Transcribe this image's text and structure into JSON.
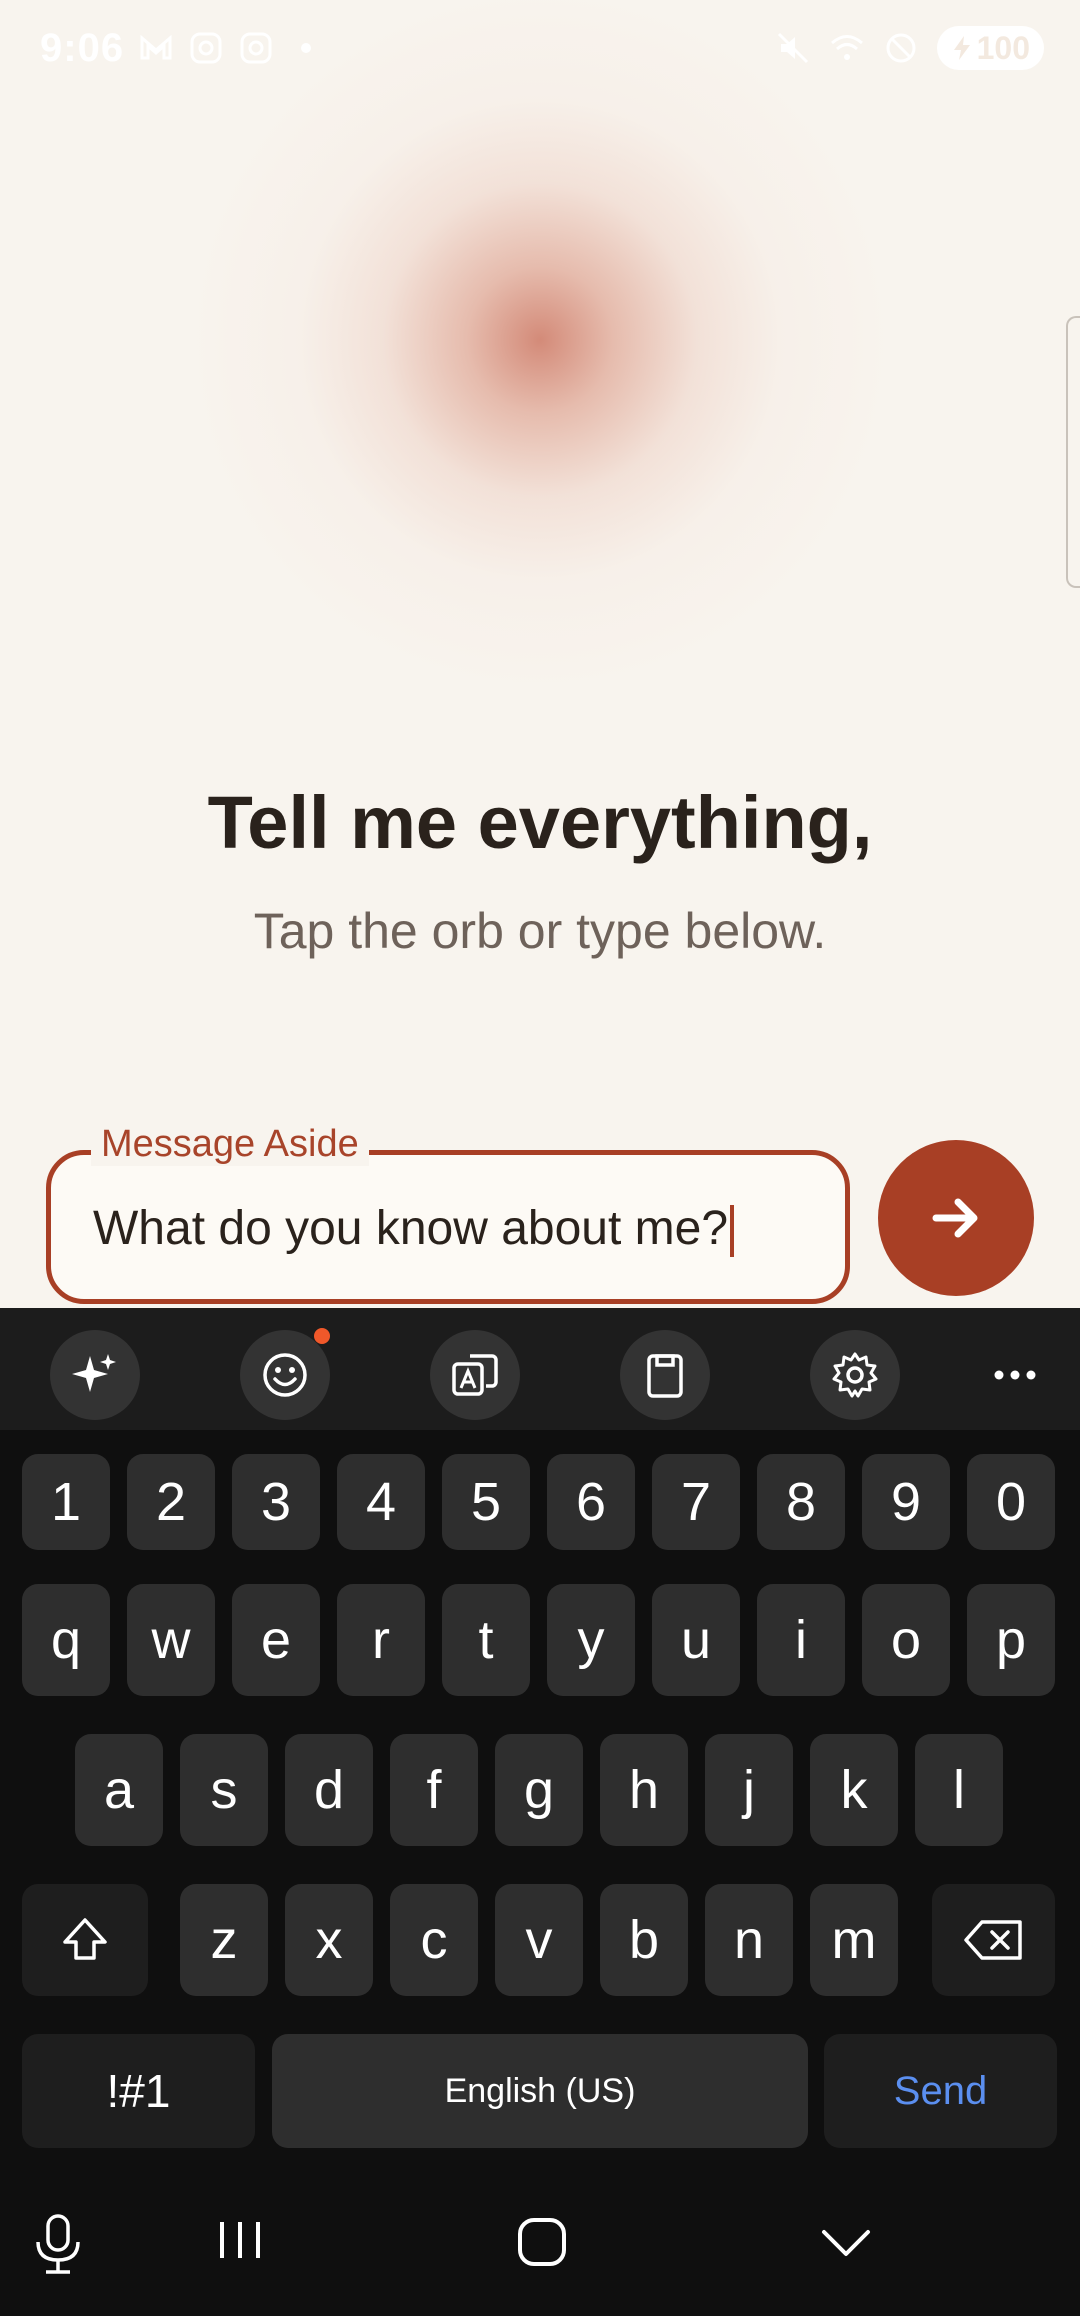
{
  "status_bar": {
    "time": "9:06",
    "left_icons": [
      "gmail-icon",
      "instagram-icon",
      "instagram-icon",
      "dot-icon"
    ],
    "right_icons": [
      "mute-icon",
      "wifi-icon",
      "dnd-icon"
    ],
    "battery": "100"
  },
  "main": {
    "headline": "Tell me everything,",
    "subline": "Tap the orb or type below."
  },
  "message": {
    "label": "Message Aside",
    "value": "What do you know about me?",
    "accent": "#a83f25"
  },
  "keyboard": {
    "toolbar": [
      "sparkle-icon",
      "emoji-icon",
      "translate-icon",
      "clipboard-icon",
      "settings-icon",
      "more-icon"
    ],
    "rows": [
      [
        "1",
        "2",
        "3",
        "4",
        "5",
        "6",
        "7",
        "8",
        "9",
        "0"
      ],
      [
        "q",
        "w",
        "e",
        "r",
        "t",
        "y",
        "u",
        "i",
        "o",
        "p"
      ],
      [
        "a",
        "s",
        "d",
        "f",
        "g",
        "h",
        "j",
        "k",
        "l"
      ],
      [
        "z",
        "x",
        "c",
        "v",
        "b",
        "n",
        "m"
      ]
    ],
    "symbols_label": "!#1",
    "space_label": "English (US)",
    "send_label": "Send"
  },
  "nav": [
    "mic-icon",
    "recents-icon",
    "home-icon",
    "hide-keyboard-icon"
  ]
}
